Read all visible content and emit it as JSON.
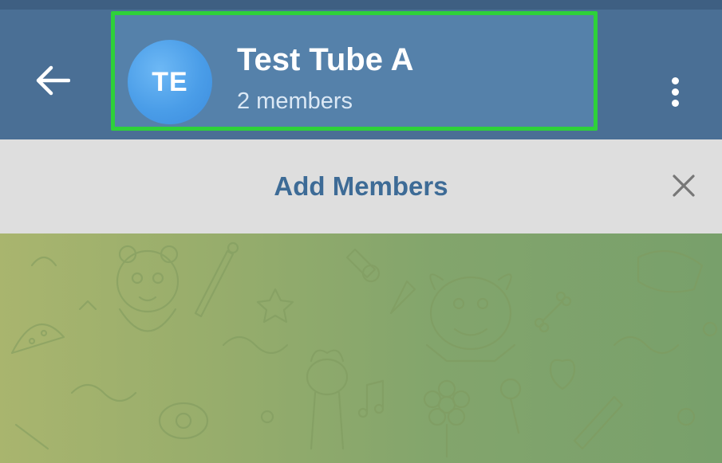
{
  "header": {
    "back_icon": "arrow-left-icon",
    "avatar_initials": "TE",
    "title": "Test Tube A",
    "subtitle": "2 members",
    "menu_icon": "more-vertical-icon",
    "colors": {
      "header_bg": "#4a6f95",
      "highlight_border": "#2ed13a",
      "avatar": "#4a9de8"
    }
  },
  "add_bar": {
    "label": "Add Members",
    "close_icon": "close-icon",
    "colors": {
      "bg": "#dedede",
      "text": "#3d6b96"
    }
  },
  "chat_background": {
    "pattern": "doodle-wallpaper",
    "colors": {
      "left": "#a9b56e",
      "right": "#78a06b"
    }
  }
}
